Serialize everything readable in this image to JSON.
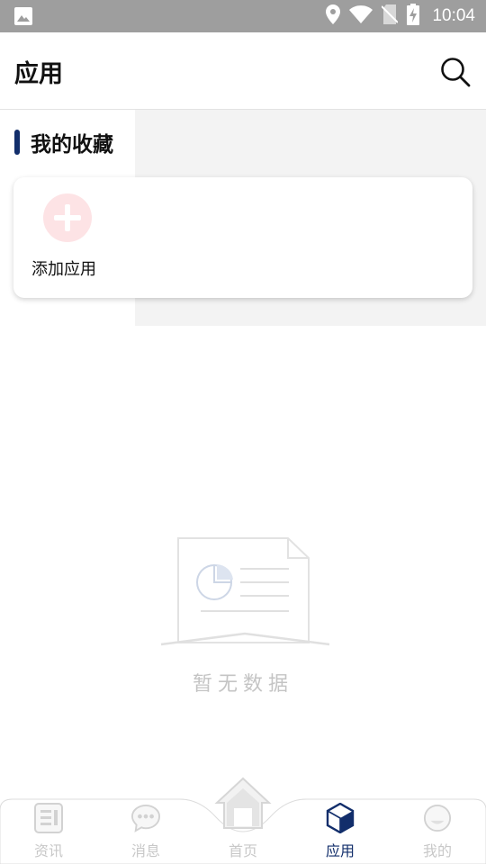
{
  "status_bar": {
    "time": "10:04",
    "icons": [
      "image-icon",
      "location-icon",
      "wifi-icon",
      "no-sim-icon",
      "battery-charging-icon"
    ]
  },
  "header": {
    "title": "应用",
    "search_icon": "search-icon"
  },
  "favorites": {
    "title": "我的收藏",
    "add_label": "添加应用",
    "accent": "#122e6b",
    "add_color": "#fde3e5"
  },
  "empty_state": {
    "text": "暂无数据",
    "icon": "empty-document-chart-icon"
  },
  "bottom_nav": {
    "items": [
      {
        "label": "资讯",
        "icon": "news-icon",
        "active": false
      },
      {
        "label": "消息",
        "icon": "message-icon",
        "active": false
      },
      {
        "label": "首页",
        "icon": "home-icon",
        "active": false
      },
      {
        "label": "应用",
        "icon": "app-cube-icon",
        "active": true
      },
      {
        "label": "我的",
        "icon": "profile-icon",
        "active": false
      }
    ],
    "active_color": "#122e6b",
    "inactive_color": "#c8c8c8"
  }
}
